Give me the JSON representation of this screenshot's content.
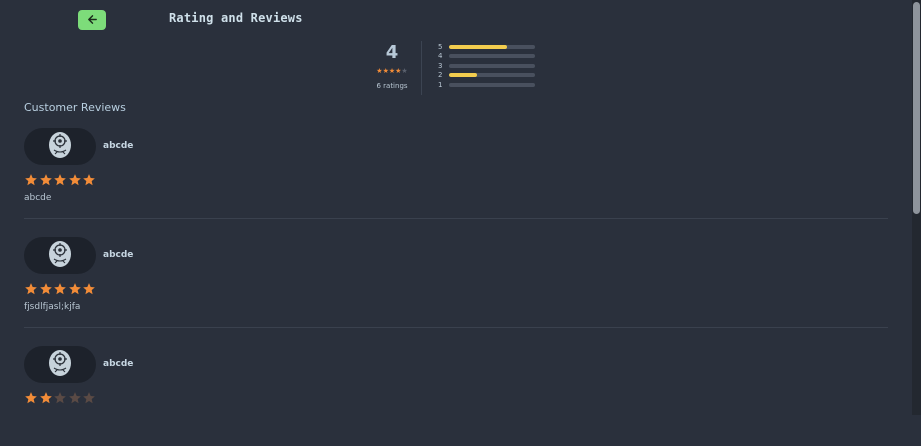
{
  "header": {
    "title": "Rating and Reviews",
    "back_icon": "arrow-left-icon"
  },
  "summary": {
    "average": "4",
    "average_stars": 4,
    "ratings_label": "6 ratings",
    "distribution": [
      {
        "label": "5",
        "fraction": 0.67
      },
      {
        "label": "4",
        "fraction": 0
      },
      {
        "label": "3",
        "fraction": 0
      },
      {
        "label": "2",
        "fraction": 0.33
      },
      {
        "label": "1",
        "fraction": 0
      }
    ]
  },
  "section_title": "Customer Reviews",
  "reviews": [
    {
      "name": "abcde",
      "stars": 5,
      "text": "abcde"
    },
    {
      "name": "abcde",
      "stars": 5,
      "text": "fjsdlfjasl;kjfa"
    },
    {
      "name": "abcde",
      "stars": 2,
      "text": ""
    }
  ],
  "colors": {
    "accent_green": "#7ddc7a",
    "star_on": "#f28c38",
    "bar_fill": "#f3cd4e",
    "background": "#2a303c"
  }
}
